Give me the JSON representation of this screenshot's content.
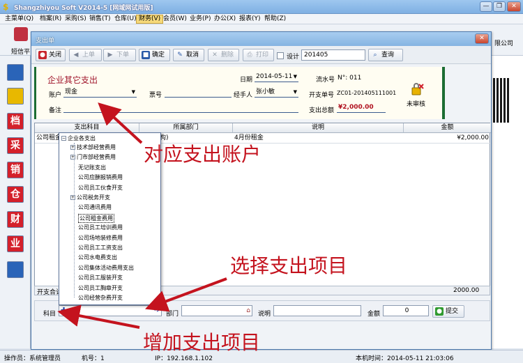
{
  "app": {
    "title": "Shangzhiyou Soft V2014-5 [网域网试用版]",
    "window_buttons": [
      "—",
      "❐",
      "✕"
    ]
  },
  "menubar": [
    {
      "label": "主菜单(Q)"
    },
    {
      "label": "档案(R)"
    },
    {
      "label": "采购(S)"
    },
    {
      "label": "销售(T)"
    },
    {
      "label": "仓库(U)"
    },
    {
      "label": "财务(V)"
    },
    {
      "label": "会员(W)"
    },
    {
      "label": "业务(P)"
    },
    {
      "label": "办公(X)"
    },
    {
      "label": "报表(Y)"
    },
    {
      "label": "帮助(Z)"
    }
  ],
  "main_toolbar": {
    "first_label": "短信平",
    "right_label": "限公司"
  },
  "left_toolbar": [
    {
      "label": "",
      "icon": "flag-icon",
      "color": "#2a64b8"
    },
    {
      "label": "",
      "icon": "bulb-icon",
      "color": "#e8b800"
    },
    {
      "label": "档",
      "icon": "archive-icon",
      "color": "#d4202a"
    },
    {
      "label": "采",
      "icon": "purchase-icon",
      "color": "#d4202a"
    },
    {
      "label": "销",
      "icon": "sales-icon",
      "color": "#d4202a"
    },
    {
      "label": "仓",
      "icon": "warehouse-icon",
      "color": "#d4202a"
    },
    {
      "label": "财",
      "icon": "finance-icon",
      "color": "#d4202a"
    },
    {
      "label": "业",
      "icon": "business-icon",
      "color": "#d4202a"
    },
    {
      "label": "",
      "icon": "exit-door-icon",
      "color": "#2a64b8"
    }
  ],
  "dialog": {
    "title": "支出单",
    "toolbar": {
      "close": "关闭",
      "prev": "上单",
      "next": "下单",
      "confirm": "确定",
      "cancel": "取消",
      "delete": "删除",
      "print": "打印",
      "design": "设计",
      "search_value": "201405",
      "query": "查询"
    },
    "form": {
      "title": "企业其它支出",
      "date_label": "日期",
      "date_value": "2014-05-11",
      "serial_label": "流水号",
      "serial_value": "N°: 011",
      "account_label": "账户",
      "account_value": "现金",
      "ticket_label": "票号",
      "ticket_value": "",
      "handler_label": "经手人",
      "handler_value": "张小敏",
      "bill_label": "开支单号",
      "bill_value": "ZC01-201405111001",
      "note_label": "备注",
      "note_value": "",
      "total_label": "支出总额",
      "total_value": "¥2,000.00",
      "status": "未审核"
    },
    "grid": {
      "columns": [
        "支出科目",
        "所属部门",
        "说明",
        "金额"
      ],
      "rows": [
        {
          "subject": "公司租金",
          "dept": "部门结构)",
          "note": "4月份租金",
          "amount": "¥2,000.00"
        }
      ],
      "total_label": "开支合计",
      "total_value": "2000.00"
    },
    "bottom": {
      "subject_label": "科目",
      "dept_label": "部门",
      "note_label": "说明",
      "amount_label": "金额",
      "amount_value": "0",
      "submit": "提交"
    },
    "tree": {
      "root": "企业各支出",
      "items": [
        {
          "label": "技术部经营费用",
          "expand": "+"
        },
        {
          "label": "门市部经营费用",
          "expand": "+"
        },
        {
          "label": "无记账支出",
          "expand": ""
        },
        {
          "label": "公司应酬报销费用",
          "expand": ""
        },
        {
          "label": "公司员工伙食开支",
          "expand": ""
        },
        {
          "label": "公司税务开支",
          "expand": "+"
        },
        {
          "label": "公司通讯费用",
          "expand": ""
        },
        {
          "label": "公司租金费用",
          "expand": "",
          "selected": true
        },
        {
          "label": "公司员工培训费用",
          "expand": ""
        },
        {
          "label": "公司场地装修费用",
          "expand": ""
        },
        {
          "label": "公司员工工资支出",
          "expand": ""
        },
        {
          "label": "公司水电费支出",
          "expand": ""
        },
        {
          "label": "公司集体活动费用支出",
          "expand": ""
        },
        {
          "label": "公司员工服装开支",
          "expand": ""
        },
        {
          "label": "公司员工胸章开支",
          "expand": ""
        },
        {
          "label": "公司经营杂费开支",
          "expand": ""
        }
      ]
    }
  },
  "annotations": {
    "a1": "对应支出账户",
    "a2": "选择支出项目",
    "a3": "增加支出项目"
  },
  "statusbar": {
    "operator": "操作员：系统管理员",
    "machine": "机号：1",
    "ip": "IP：192.168.1.102",
    "time": "本机时间：2014-05-11 21:03:06"
  },
  "colors": {
    "accent_red": "#c4131e",
    "form_green": "#1c6d33",
    "title_blue": "#85b4e2"
  }
}
